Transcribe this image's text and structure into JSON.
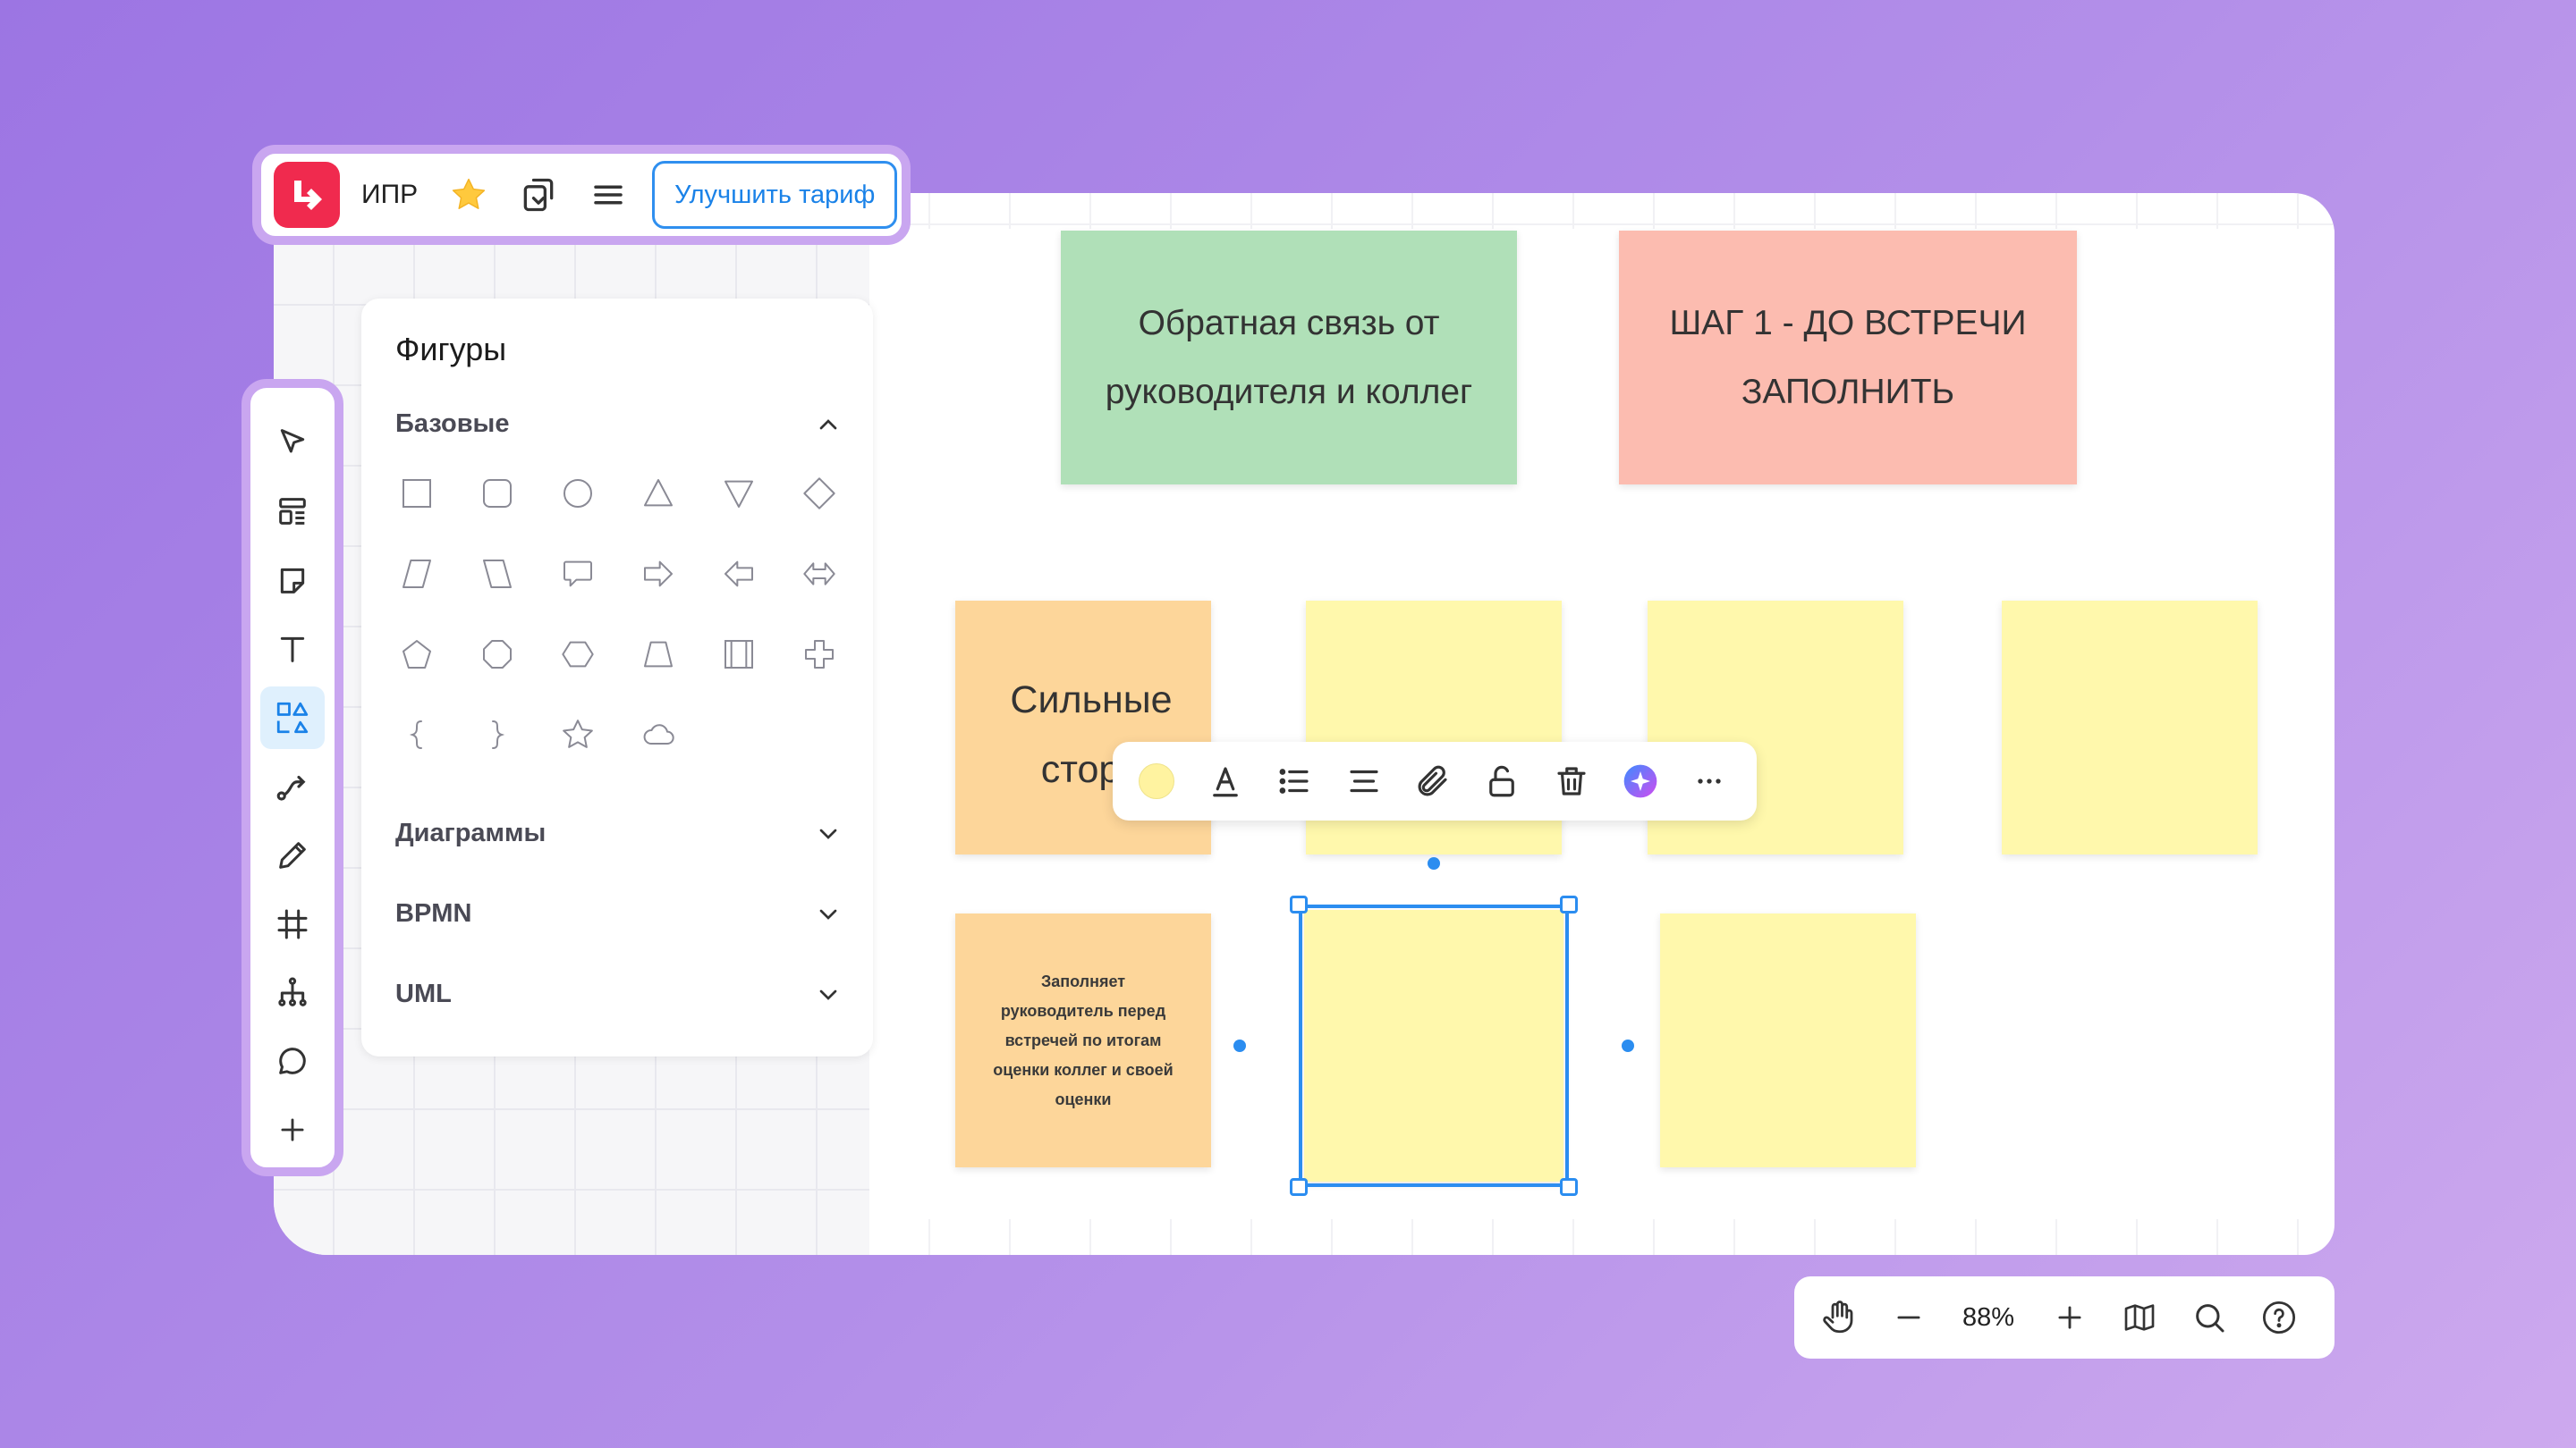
{
  "app": {
    "board_name": "ИПР",
    "upgrade_label": "Улучшить тариф",
    "accent": "#f02a4e",
    "selection_color": "#2b8df0"
  },
  "left_toolbar": {
    "items": [
      {
        "icon": "pointer-icon"
      },
      {
        "icon": "templates-icon"
      },
      {
        "icon": "sticky-note-icon"
      },
      {
        "icon": "text-icon"
      },
      {
        "icon": "shapes-icon",
        "active": true
      },
      {
        "icon": "connector-icon"
      },
      {
        "icon": "pen-icon"
      },
      {
        "icon": "frame-icon"
      },
      {
        "icon": "mindmap-icon"
      },
      {
        "icon": "comment-icon"
      },
      {
        "icon": "plus-icon"
      }
    ]
  },
  "shapes_panel": {
    "title": "Фигуры",
    "sections": [
      {
        "title": "Базовые",
        "expanded": true
      },
      {
        "title": "Диаграммы",
        "expanded": false
      },
      {
        "title": "BPMN",
        "expanded": false
      },
      {
        "title": "UML",
        "expanded": false
      }
    ],
    "basic_shapes": [
      "rectangle",
      "rounded-rectangle",
      "circle",
      "triangle",
      "inverted-triangle",
      "diamond",
      "parallelogram",
      "trapezoid-right",
      "speech-bubble",
      "arrow-right",
      "arrow-left",
      "double-arrow",
      "pentagon",
      "octagon",
      "hexagon",
      "trapezoid",
      "process-box",
      "cross",
      "brace-left",
      "brace-right",
      "star",
      "cloud"
    ]
  },
  "stickies": {
    "feedback_header": "Обратная связь от руководителя и коллег",
    "step_header": "ШАГ 1  - ДО ВСТРЕЧИ ЗАПОЛНИТЬ",
    "strengths": "Сильные сторо",
    "manager_note": "Заполняет руководитель перед встречей по итогам оценки коллег и своей оценки",
    "colors": {
      "green": "#b0e0b8",
      "salmon": "#fcbcb0",
      "orange": "#fdd69a",
      "yellow": "#fff8ac"
    }
  },
  "context_toolbar": {
    "items": [
      "color-swatch",
      "text-color-icon",
      "list-icon",
      "align-icon",
      "attach-icon",
      "unlock-icon",
      "trash-icon",
      "ai-icon",
      "more-icon"
    ]
  },
  "zoom": {
    "value": "88%"
  }
}
